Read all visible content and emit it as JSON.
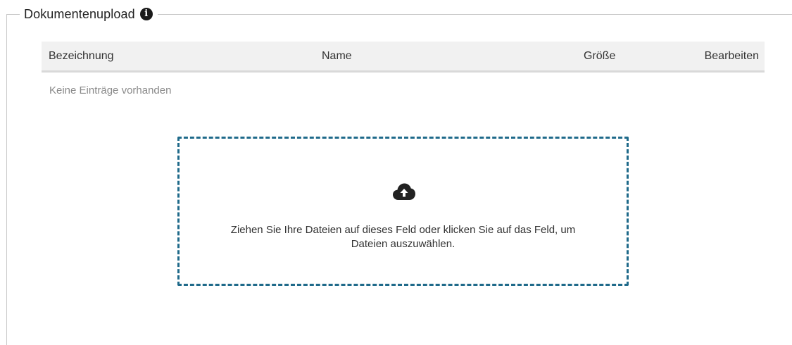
{
  "upload": {
    "title": "Dokumentenupload",
    "info_icon": "info-circle-icon",
    "table": {
      "columns": [
        "Bezeichnung",
        "Name",
        "Größe",
        "Bearbeiten"
      ],
      "empty_text": "Keine Einträge vorhanden"
    },
    "dropzone": {
      "icon": "cloud-upload-icon",
      "line1": "Ziehen Sie Ihre Dateien auf dieses Feld oder klicken Sie auf das Feld, um",
      "line2": "Dateien auszuwählen."
    }
  },
  "colors": {
    "dropzone_border": "#1f6a8a",
    "header_bg": "#f1f1f1",
    "fieldset_border": "#c8c8c8"
  }
}
